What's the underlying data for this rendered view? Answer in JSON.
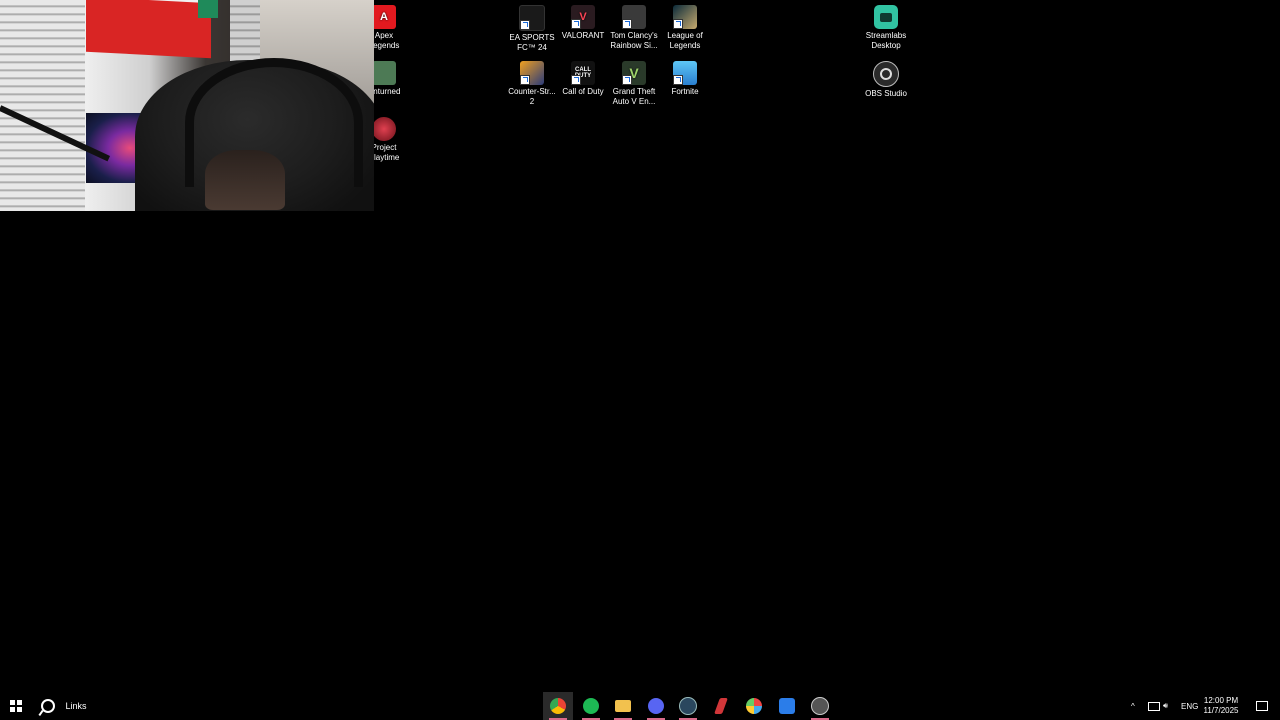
{
  "desktop": {
    "partial_icons": [
      {
        "label": "Apex\nLegends",
        "icon": "apex-legends-icon",
        "color": "#e2191f"
      },
      {
        "label": "Unturned",
        "icon": "unturned-icon",
        "color": "#4d7a55"
      },
      {
        "label": "Project\nPlaytime",
        "icon": "project-playtime-icon",
        "color": "#b0202a"
      }
    ],
    "icons": [
      {
        "label": "EA SPORTS\nFC™ 24",
        "icon": "ea-sports-fc-icon",
        "color": "#1a1a1a"
      },
      {
        "label": "VALORANT",
        "icon": "valorant-icon",
        "color": "#2a1b20"
      },
      {
        "label": "Tom Clancy's\nRainbow Si...",
        "icon": "rainbow-six-icon",
        "color": "#3a3a3a"
      },
      {
        "label": "League of\nLegends",
        "icon": "league-of-legends-icon",
        "color": "#1d3b4a"
      },
      {
        "label": "Streamlabs\nDesktop",
        "icon": "streamlabs-icon",
        "color": "#31c3a2"
      },
      {
        "label": "Counter-Str...\n2",
        "icon": "counter-strike-icon",
        "color": "#2b3b7a"
      },
      {
        "label": "Call of Duty",
        "icon": "call-of-duty-icon",
        "color": "#111111"
      },
      {
        "label": "Grand Theft\nAuto V En...",
        "icon": "gta-v-icon",
        "color": "#2a3a2a"
      },
      {
        "label": "Fortnite",
        "icon": "fortnite-icon",
        "color": "#3aa3e0"
      },
      {
        "label": "OBS Studio",
        "icon": "obs-studio-icon",
        "color": "#2a2a2a"
      }
    ],
    "icon_glyphs": {
      "apex": "A",
      "cod": "CALL\nDUTY",
      "gta": "V"
    }
  },
  "taskbar": {
    "links_label": "Links",
    "apps": [
      {
        "name": "chrome-icon",
        "color": "#4285f4",
        "active": true
      },
      {
        "name": "spotify-icon",
        "color": "#1db954",
        "active": false
      },
      {
        "name": "file-explorer-icon",
        "color": "#f2c14e",
        "active": false
      },
      {
        "name": "discord-icon",
        "color": "#5865f2",
        "active": false
      },
      {
        "name": "steam-icon",
        "color": "#2a475e",
        "active": false
      },
      {
        "name": "riot-client-icon",
        "color": "#d13639",
        "active": false
      },
      {
        "name": "pinwheel-app-icon",
        "color": "#cccccc",
        "active": false
      },
      {
        "name": "blue-app-icon",
        "color": "#2b7de9",
        "active": false
      },
      {
        "name": "obs-taskbar-icon",
        "color": "#555555",
        "active": false
      }
    ],
    "tray": {
      "language": "ENG",
      "time": "12:00 PM",
      "date": "11/7/2025"
    }
  }
}
